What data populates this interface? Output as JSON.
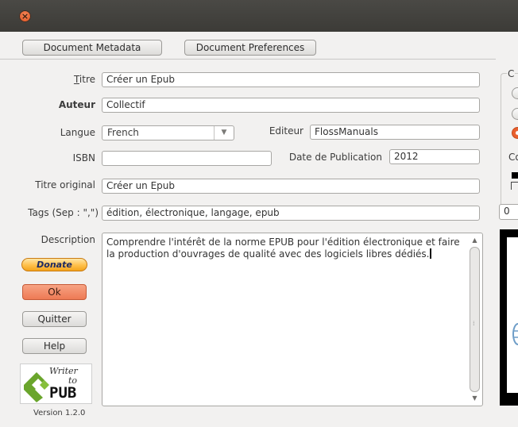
{
  "window": {
    "close_glyph": "×"
  },
  "tabs": {
    "metadata": "Document Metadata",
    "preferences": "Document Preferences"
  },
  "form": {
    "titre_label": "Titre",
    "titre_value": "Créer un Epub",
    "auteur_label": "Auteur",
    "auteur_value": "Collectif",
    "langue_label": "Langue",
    "langue_value": "French",
    "editeur_label": "Editeur",
    "editeur_value": "FlossManuals",
    "isbn_label": "ISBN",
    "isbn_value": "",
    "date_label": "Date de Publication",
    "date_value": "2012",
    "titre_original_label": "Titre original",
    "titre_original_value": "Créer un Epub",
    "tags_label": "Tags (Sep : \",\")",
    "tags_value": "édition, électronique, langage, epub",
    "description_label": "Description",
    "description_value": "Comprendre l'intérêt de la norme EPUB pour l'édition électronique et faire la production d'ouvrages de qualité avec des logiciels libres dédiés."
  },
  "buttons": {
    "donate": "Donate",
    "ok": "Ok",
    "quitter": "Quitter",
    "help": "Help"
  },
  "logo": {
    "line1": "Writer",
    "line2": "to",
    "line3": "PUB"
  },
  "version": "Version 1.2.0",
  "right_panel": {
    "group_label": "C",
    "second_label": "Co",
    "spin_value": "0"
  },
  "colors": {
    "accent": "#ee7a54",
    "titlebar": "#3c3b37",
    "donate": "#ffc04a"
  }
}
